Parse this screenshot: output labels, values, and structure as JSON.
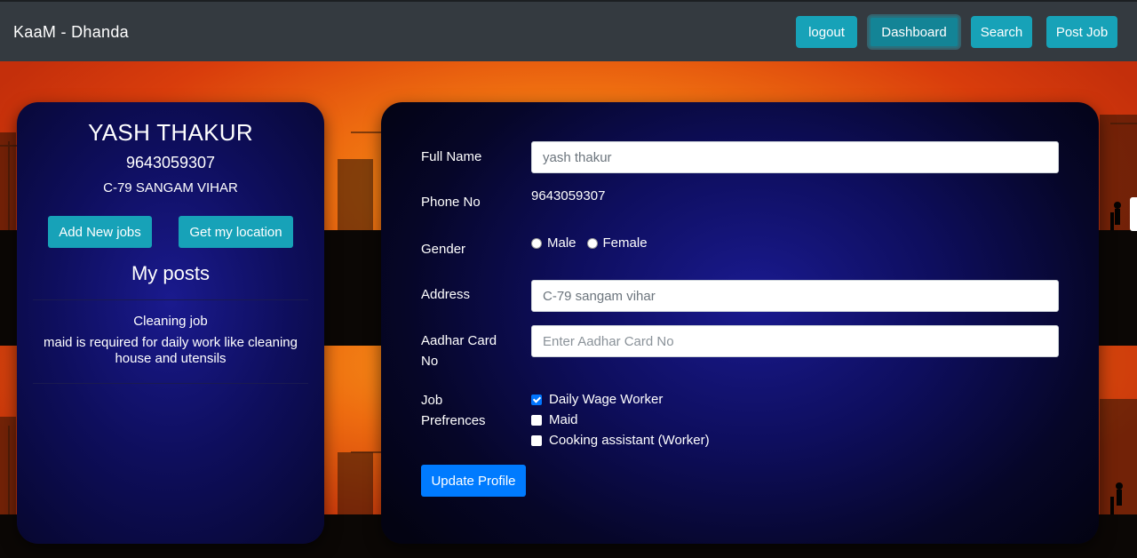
{
  "navbar": {
    "brand": "KaaM - Dhanda",
    "buttons": {
      "logout": "logout",
      "dashboard": "Dashboard",
      "search": "Search",
      "post_job": "Post Job"
    }
  },
  "profile": {
    "name": "YASH THAKUR",
    "phone": "9643059307",
    "address": "C-79 SANGAM VIHAR",
    "add_jobs_label": "Add New jobs",
    "location_label": "Get my location",
    "posts_title": "My posts",
    "posts": [
      {
        "title": "Cleaning job",
        "description": "maid is required for daily work like cleaning house and utensils"
      }
    ]
  },
  "form": {
    "full_name": {
      "label": "Full Name",
      "value": "yash thakur"
    },
    "phone": {
      "label": "Phone No",
      "value": "9643059307"
    },
    "gender": {
      "label": "Gender",
      "options": [
        "Male",
        "Female"
      ]
    },
    "address": {
      "label": "Address",
      "value": "C-79 sangam vihar"
    },
    "aadhar": {
      "label_line1": "Aadhar Card",
      "label_line2": "No",
      "placeholder": "Enter Aadhar Card No"
    },
    "job_prefs": {
      "label_line1": "Job",
      "label_line2": "Prefrences",
      "options": [
        {
          "label": "Daily Wage Worker",
          "checked": true
        },
        {
          "label": "Maid",
          "checked": false
        },
        {
          "label": "Cooking assistant (Worker)",
          "checked": false
        }
      ]
    },
    "submit_label": "Update Profile"
  },
  "colors": {
    "navbar_bg": "#343a40",
    "info_button": "#17a2b8",
    "primary_button": "#007bff",
    "card_bg": "#0e0e5c",
    "scene_orange": "#ee6c10"
  }
}
